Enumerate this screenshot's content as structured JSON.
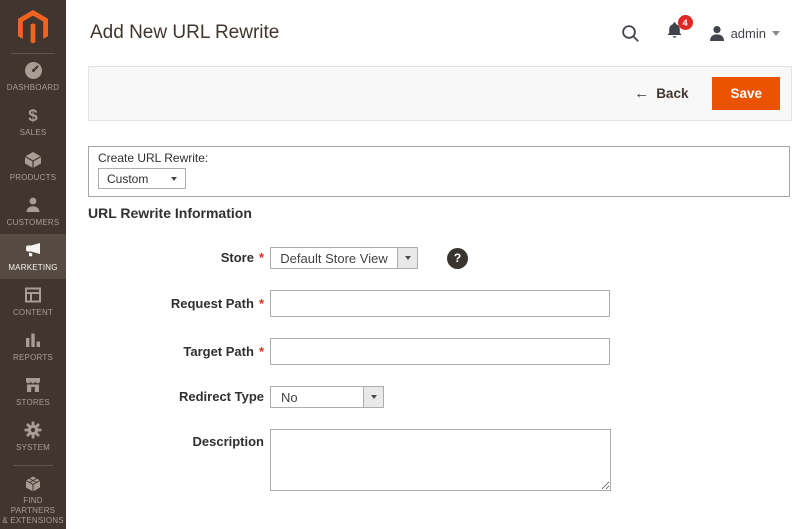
{
  "colors": {
    "accent": "#eb5202",
    "sidebar_bg": "#41362f",
    "badge": "#e22626",
    "logo_orange": "#f26322"
  },
  "sidebar": {
    "items": [
      {
        "label": "DASHBOARD",
        "icon": "dashboard-icon",
        "active": false
      },
      {
        "label": "SALES",
        "icon": "sales-icon",
        "active": false
      },
      {
        "label": "PRODUCTS",
        "icon": "products-icon",
        "active": false
      },
      {
        "label": "CUSTOMERS",
        "icon": "customers-icon",
        "active": false
      },
      {
        "label": "MARKETING",
        "icon": "marketing-icon",
        "active": true
      },
      {
        "label": "CONTENT",
        "icon": "content-icon",
        "active": false
      },
      {
        "label": "REPORTS",
        "icon": "reports-icon",
        "active": false
      },
      {
        "label": "STORES",
        "icon": "stores-icon",
        "active": false
      },
      {
        "label": "SYSTEM",
        "icon": "system-icon",
        "active": false
      }
    ],
    "footer_item": {
      "label_line1": "FIND PARTNERS",
      "label_line2": "& EXTENSIONS",
      "icon": "partners-icon"
    }
  },
  "icons": {
    "sales_glyph": "$",
    "help_glyph": "?"
  },
  "header": {
    "title": "Add New URL Rewrite",
    "username": "admin",
    "notification_count": "4"
  },
  "toolbar": {
    "back_arrow": "←",
    "back_label": "Back",
    "save_label": "Save"
  },
  "create_box": {
    "label": "Create URL Rewrite:",
    "selected_option": "Custom"
  },
  "form": {
    "heading": "URL Rewrite Information",
    "required_marker": "*",
    "fields": {
      "store": {
        "label": "Store",
        "required": true,
        "value": "Default Store View"
      },
      "request_path": {
        "label": "Request Path",
        "required": true,
        "value": ""
      },
      "target_path": {
        "label": "Target Path",
        "required": true,
        "value": ""
      },
      "redirect_type": {
        "label": "Redirect Type",
        "required": false,
        "value": "No"
      },
      "description": {
        "label": "Description",
        "value": ""
      }
    }
  }
}
